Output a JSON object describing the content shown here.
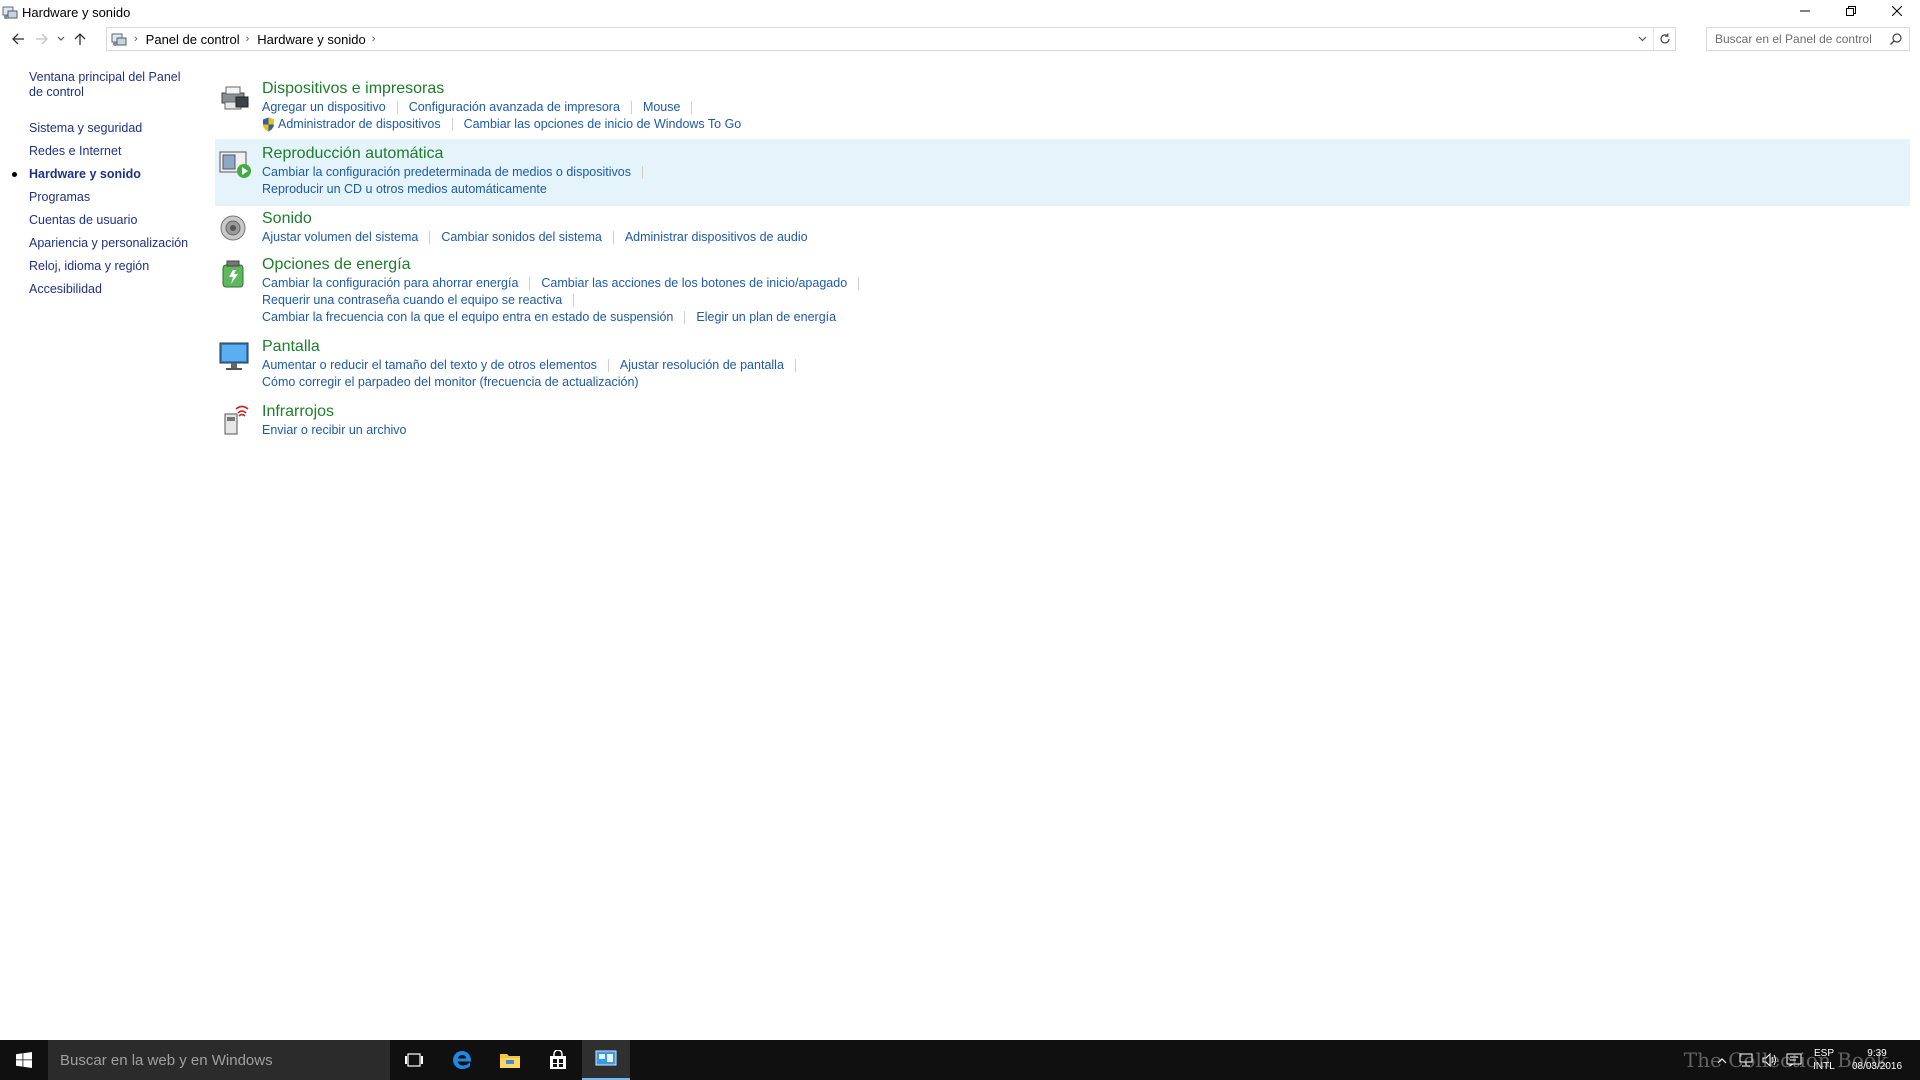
{
  "window": {
    "title": "Hardware y sonido",
    "minimize_icon": "minimize-icon",
    "maximize_icon": "restore-icon",
    "close_icon": "close-icon"
  },
  "address": {
    "crumbs": [
      "Panel de control",
      "Hardware y sonido"
    ],
    "search_placeholder": "Buscar en el Panel de control"
  },
  "sidebar": {
    "home": "Ventana principal del Panel de control",
    "items": [
      {
        "label": "Sistema y seguridad"
      },
      {
        "label": "Redes e Internet"
      },
      {
        "label": "Hardware y sonido",
        "active": true
      },
      {
        "label": "Programas"
      },
      {
        "label": "Cuentas de usuario"
      },
      {
        "label": "Apariencia y personalización"
      },
      {
        "label": "Reloj, idioma y región"
      },
      {
        "label": "Accesibilidad"
      }
    ]
  },
  "categories": [
    {
      "title": "Dispositivos e impresoras",
      "icon": "devices-printers-icon",
      "rows": [
        [
          "Agregar un dispositivo",
          "Configuración avanzada de impresora",
          "Mouse"
        ],
        [
          "Administrador de dispositivos",
          "Cambiar las opciones de inicio de Windows To Go"
        ]
      ]
    },
    {
      "title": "Reproducción automática",
      "icon": "autoplay-icon",
      "highlight": true,
      "rows": [
        [
          "Cambiar la configuración predeterminada de medios o dispositivos"
        ],
        [
          "Reproducir un CD u otros medios automáticamente"
        ]
      ]
    },
    {
      "title": "Sonido",
      "icon": "sound-icon",
      "rows": [
        [
          "Ajustar volumen del sistema",
          "Cambiar sonidos del sistema",
          "Administrar dispositivos de audio"
        ]
      ]
    },
    {
      "title": "Opciones de energía",
      "icon": "power-options-icon",
      "rows": [
        [
          "Cambiar la configuración para ahorrar energía",
          "Cambiar las acciones de los botones de inicio/apagado"
        ],
        [
          "Requerir una contraseña cuando el equipo se reactiva"
        ],
        [
          "Cambiar la frecuencia con la que el equipo entra en estado de suspensión",
          "Elegir un plan de energía"
        ]
      ]
    },
    {
      "title": "Pantalla",
      "icon": "display-icon",
      "rows": [
        [
          "Aumentar o reducir el tamaño del texto y de otros elementos",
          "Ajustar resolución de pantalla"
        ],
        [
          "Cómo corregir el parpadeo del monitor (frecuencia de actualización)"
        ]
      ]
    },
    {
      "title": "Infrarrojos",
      "icon": "infrared-icon",
      "rows": [
        [
          "Enviar o recibir un archivo"
        ]
      ]
    }
  ],
  "taskbar": {
    "search_text": "Buscar en la web y en Windows",
    "lang_top": "ESP",
    "lang_bottom": "INTL",
    "time": "9:39",
    "date": "08/03/2016",
    "watermark": "The Collection Book"
  }
}
